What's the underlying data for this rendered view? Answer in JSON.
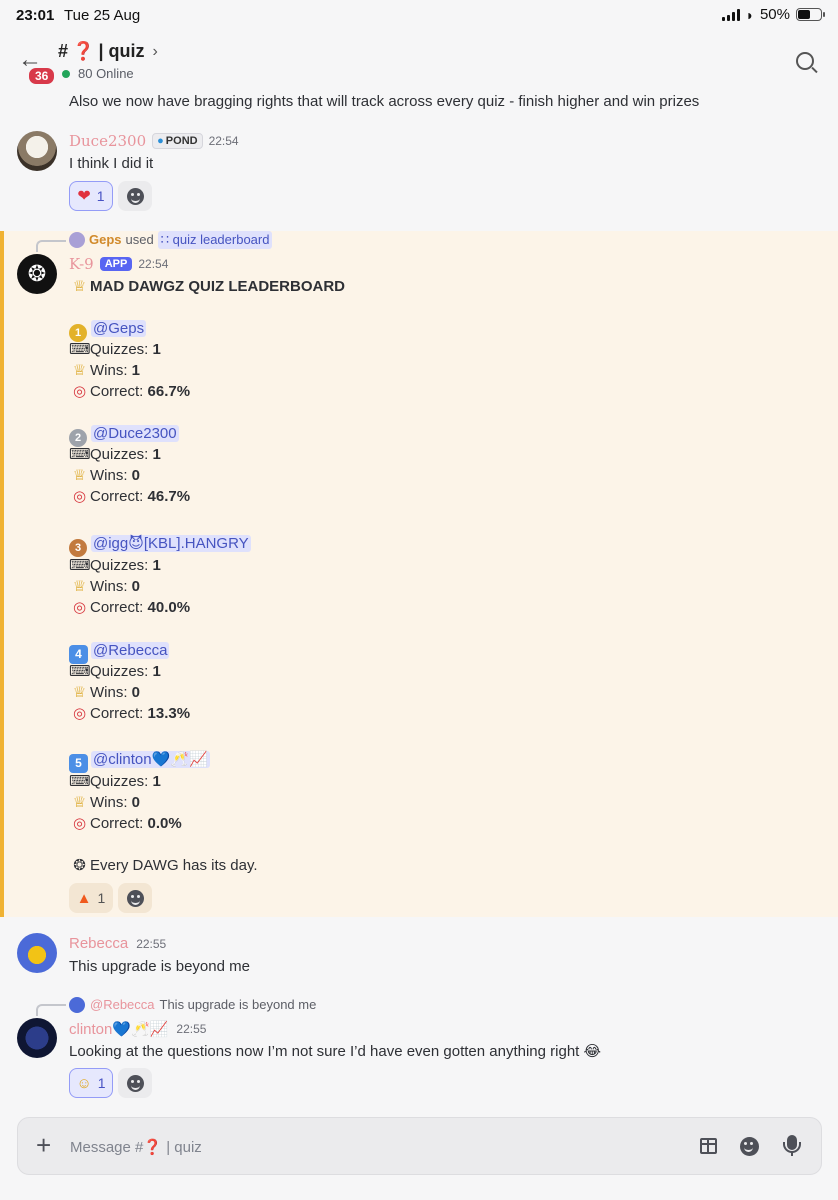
{
  "status_bar": {
    "time": "23:01",
    "date": "Tue 25 Aug",
    "battery": "50%"
  },
  "header": {
    "hash": "#",
    "qmark": "❓",
    "channel": "| quiz",
    "badge": "36",
    "online": "80 Online"
  },
  "messages": {
    "top_line": "Also we now have bragging rights that will track across every quiz - finish higher and win prizes",
    "duce": {
      "username": "Duce2300",
      "tag": "POND",
      "time": "22:54",
      "text": "I think I did it",
      "reaction_count": "1"
    },
    "k9": {
      "reply_user": "Geps",
      "reply_used": "used",
      "reply_command": "quiz leaderboard",
      "username": "K-9",
      "app_tag": "APP",
      "time": "22:54",
      "title": "MAD DAWGZ QUIZ LEADERBOARD",
      "labels": {
        "quizzes": "Quizzes:",
        "wins": "Wins:",
        "correct": "Correct:"
      },
      "entries": [
        {
          "rank": "1",
          "name": "@Geps",
          "quizzes": "1",
          "wins": "1",
          "correct": "66.7%"
        },
        {
          "rank": "2",
          "name": "@Duce2300",
          "quizzes": "1",
          "wins": "0",
          "correct": "46.7%"
        },
        {
          "rank": "3",
          "name": "@igg😈[KBL].HANGRY",
          "quizzes": "1",
          "wins": "0",
          "correct": "40.0%"
        },
        {
          "rank": "4",
          "name": "@Rebecca",
          "quizzes": "1",
          "wins": "0",
          "correct": "13.3%"
        },
        {
          "rank": "5",
          "name": "@clinton💙🥂📈",
          "quizzes": "1",
          "wins": "0",
          "correct": "0.0%"
        }
      ],
      "footer": "Every DAWG has its day.",
      "reaction_count": "1"
    },
    "rebecca": {
      "username": "Rebecca",
      "time": "22:55",
      "text": "This upgrade is beyond me"
    },
    "clinton": {
      "reply_user": "@Rebecca",
      "reply_text": "This upgrade is beyond me",
      "username": "clinton💙🥂📈",
      "time": "22:55",
      "text": "Looking at the questions now I’m not sure I’d have even gotten anything right 😂",
      "reaction_count": "1"
    }
  },
  "composer": {
    "placeholder": "Message #❓ | quiz"
  },
  "colors": {
    "duce_name": "#e8949c",
    "k9_name": "#e8949c",
    "rebecca_name": "#e8949c",
    "clinton_name": "#e8949c",
    "highlight_bg": "#fcf4e8",
    "highlight_bar": "#f0b232",
    "accent": "#5865f2"
  }
}
